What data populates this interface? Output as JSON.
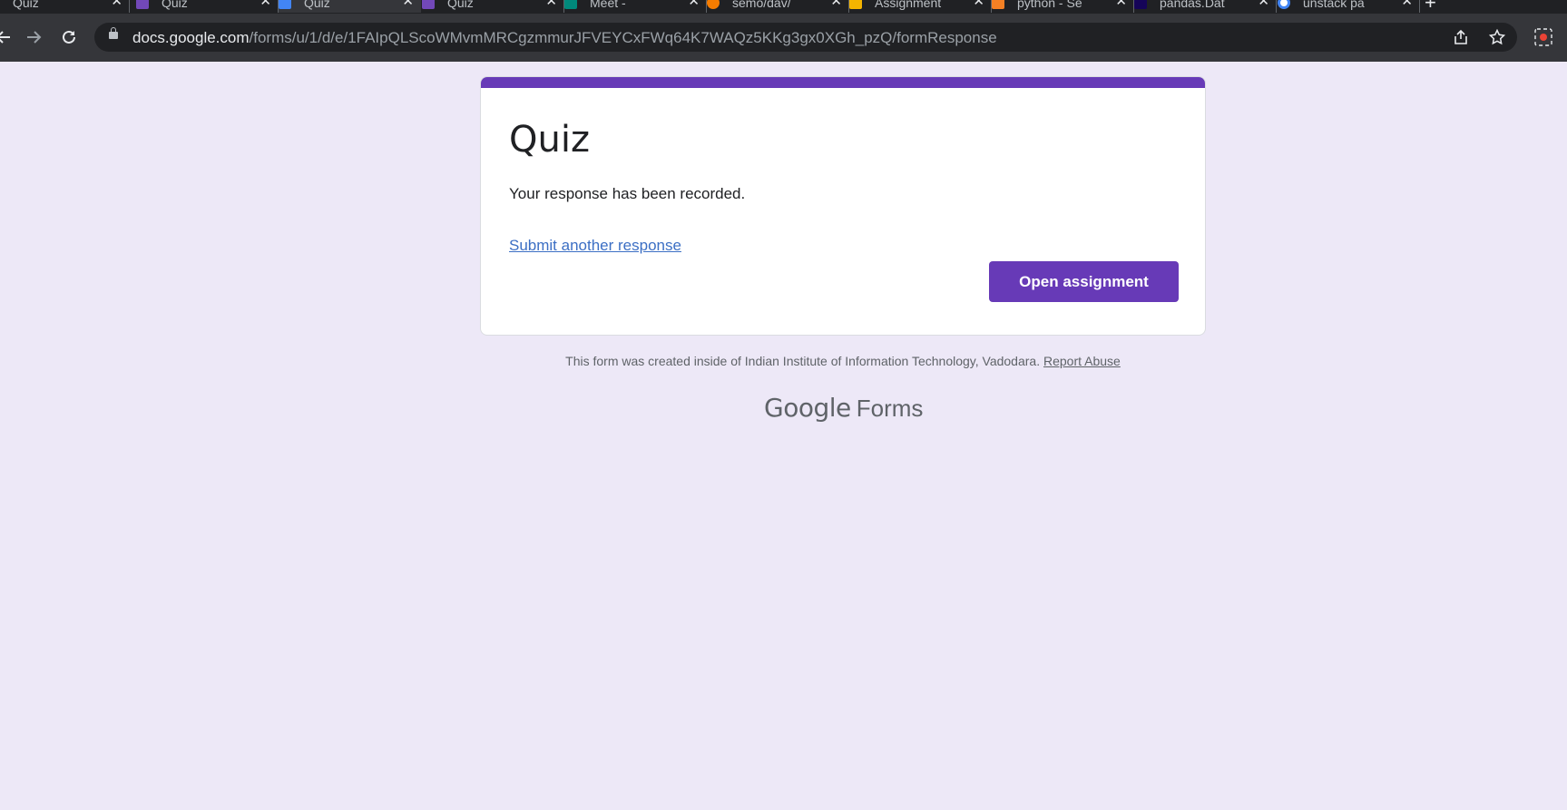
{
  "browser": {
    "tabs": [
      {
        "title": "Quiz",
        "favicon_color": "#4285f4",
        "icon": "classroom-icon",
        "active": false
      },
      {
        "title": "Quiz",
        "favicon_color": "#7248b9",
        "icon": "forms-icon",
        "active": false
      },
      {
        "title": "Quiz",
        "favicon_color": "#4285f4",
        "icon": "classroom-icon",
        "active": true
      },
      {
        "title": "Quiz",
        "favicon_color": "#7248b9",
        "icon": "forms-icon",
        "active": false
      },
      {
        "title": "Meet -",
        "favicon_color": "#00897b",
        "icon": "meet-icon",
        "active": false
      },
      {
        "title": "semo/dav/",
        "favicon_color": "#f57c00",
        "icon": "jupyter-icon",
        "active": false
      },
      {
        "title": "Assignment",
        "favicon_color": "#f4b400",
        "icon": "assignment-icon",
        "active": false
      },
      {
        "title": "python - Se",
        "favicon_color": "#f48024",
        "icon": "stackoverflow-icon",
        "active": false
      },
      {
        "title": "pandas.Dat",
        "favicon_color": "#150458",
        "icon": "pandas-icon",
        "active": false
      },
      {
        "title": "unstack pa",
        "favicon_color": "#4285f4",
        "icon": "google-icon",
        "active": false
      }
    ],
    "url_host": "docs.google.com",
    "url_path": "/forms/u/1/d/e/1FAIpQLScoWMvmMRCgzmmurJFVEYCxFWq64K7WAQz5KKg3gx0XGh_pzQ/formResponse"
  },
  "form": {
    "title": "Quiz",
    "confirmation": "Your response has been recorded.",
    "submit_another": "Submit another response",
    "open_assignment": "Open assignment",
    "accent_color": "#673ab7"
  },
  "footer": {
    "note": "This form was created inside of Indian Institute of Information Technology, Vadodara.",
    "report_abuse": "Report Abuse",
    "logo_google": "Google",
    "logo_forms": "Forms"
  }
}
